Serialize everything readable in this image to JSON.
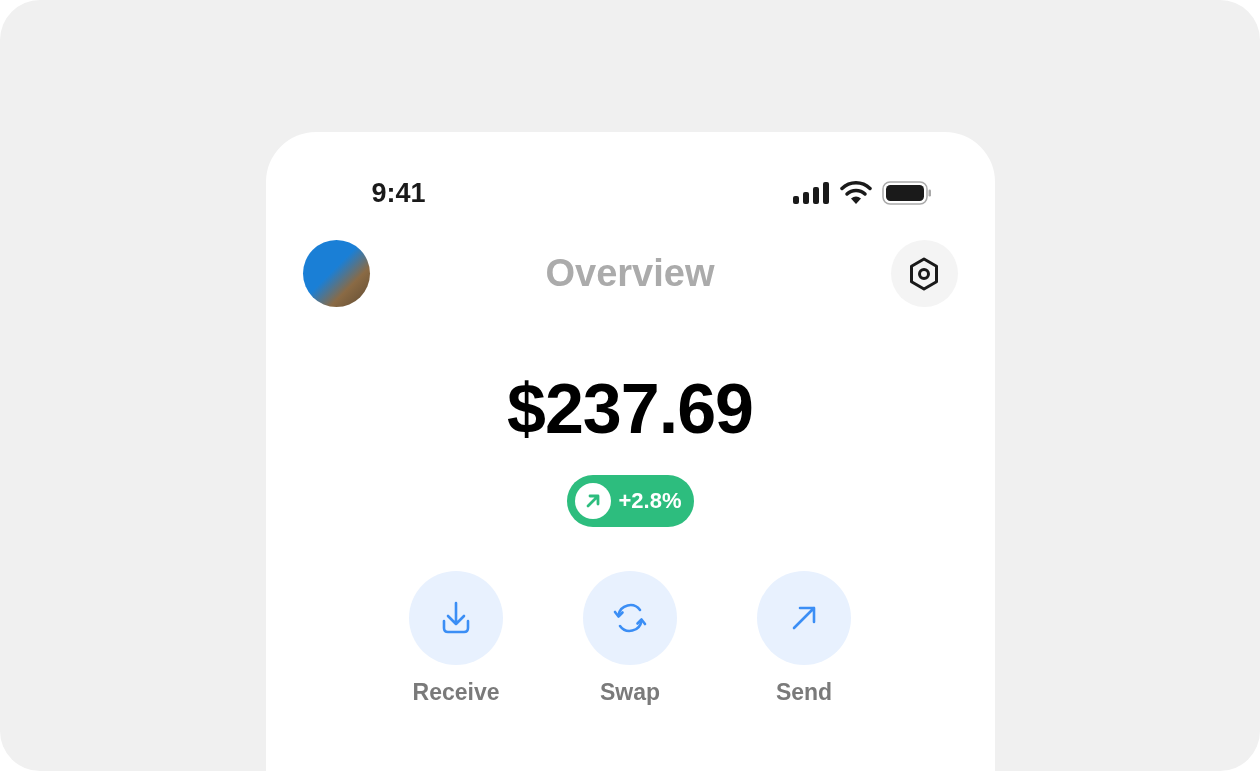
{
  "status_bar": {
    "time": "9:41"
  },
  "header": {
    "title": "Overview"
  },
  "balance": {
    "amount": "$237.69",
    "change": {
      "kind": "up",
      "text": "+2.8%"
    }
  },
  "actions": [
    {
      "kind": "receive",
      "label": "Receive"
    },
    {
      "kind": "swap",
      "label": "Swap"
    },
    {
      "kind": "send",
      "label": "Send"
    }
  ]
}
